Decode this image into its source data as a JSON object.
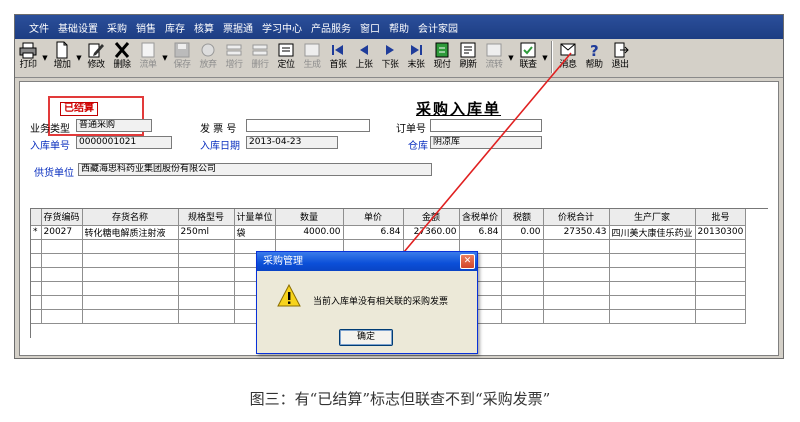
{
  "menubar": {
    "items": [
      "文件",
      "基础设置",
      "采购",
      "销售",
      "库存",
      "核算",
      "票据通",
      "学习中心",
      "产品服务",
      "窗口",
      "帮助",
      "会计家园"
    ]
  },
  "toolbar": {
    "buttons": [
      {
        "label": "打印",
        "icon": "printer-icon",
        "enabled": true
      },
      {
        "label": "增加",
        "icon": "new-doc-icon",
        "enabled": true
      },
      {
        "label": "修改",
        "icon": "edit-icon",
        "enabled": true
      },
      {
        "label": "删除",
        "icon": "delete-x-icon",
        "enabled": true
      },
      {
        "label": "流单",
        "icon": "flow-icon",
        "enabled": false
      },
      {
        "label": "保存",
        "icon": "save-icon",
        "enabled": false
      },
      {
        "label": "放弃",
        "icon": "discard-icon",
        "enabled": false
      },
      {
        "label": "增行",
        "icon": "add-row-icon",
        "enabled": false
      },
      {
        "label": "删行",
        "icon": "delete-row-icon",
        "enabled": false
      },
      {
        "label": "定位",
        "icon": "locate-icon",
        "enabled": true
      },
      {
        "label": "生成",
        "icon": "generate-icon",
        "enabled": false
      },
      {
        "label": "首张",
        "icon": "first-record-icon",
        "enabled": true
      },
      {
        "label": "上张",
        "icon": "prev-record-icon",
        "enabled": true
      },
      {
        "label": "下张",
        "icon": "next-record-icon",
        "enabled": true
      },
      {
        "label": "末张",
        "icon": "last-record-icon",
        "enabled": true
      },
      {
        "label": "现付",
        "icon": "cash-pay-icon",
        "enabled": true
      },
      {
        "label": "刷新",
        "icon": "refresh-icon",
        "enabled": true
      },
      {
        "label": "流转",
        "icon": "transfer-icon",
        "enabled": false
      },
      {
        "label": "联查",
        "icon": "linked-query-icon",
        "enabled": true
      },
      {
        "label": "消息",
        "icon": "message-icon",
        "enabled": true
      },
      {
        "label": "帮助",
        "icon": "help-icon",
        "enabled": true
      },
      {
        "label": "退出",
        "icon": "exit-icon",
        "enabled": true
      }
    ]
  },
  "form": {
    "title": "采购入库单",
    "status_stamp": "已结算",
    "biz_type_label": "业务类型",
    "biz_type_value": "普通采购",
    "invoice_no_label": "发 票 号",
    "invoice_no_value": "",
    "order_no_label": "订单号",
    "order_no_value": "",
    "inbound_no_label": "入库单号",
    "inbound_no_value": "0000001021",
    "inbound_date_label": "入库日期",
    "inbound_date_value": "2013-04-23",
    "warehouse_label": "仓库",
    "warehouse_value": "阴凉库",
    "supplier_label": "供货单位",
    "supplier_value": "西藏海思科药业集团股份有限公司"
  },
  "grid": {
    "headers": [
      "",
      "存货编码",
      "存货名称",
      "规格型号",
      "计量单位",
      "数量",
      "单价",
      "金额",
      "含税单价",
      "税额",
      "价税合计",
      "生产厂家",
      "批号"
    ],
    "rows": [
      [
        "*",
        "20027",
        "转化糖电解质注射液",
        "250ml",
        "袋",
        "4000.00",
        "6.84",
        "27360.00",
        "6.84",
        "0.00",
        "27350.43",
        "四川美大康佳乐药业",
        "20130300"
      ]
    ]
  },
  "dialog": {
    "title": "采购管理",
    "message": "当前入库单没有相关联的采购发票",
    "ok_label": "确定"
  },
  "caption": "图三：有“已结算”标志但联查不到“采购发票”"
}
